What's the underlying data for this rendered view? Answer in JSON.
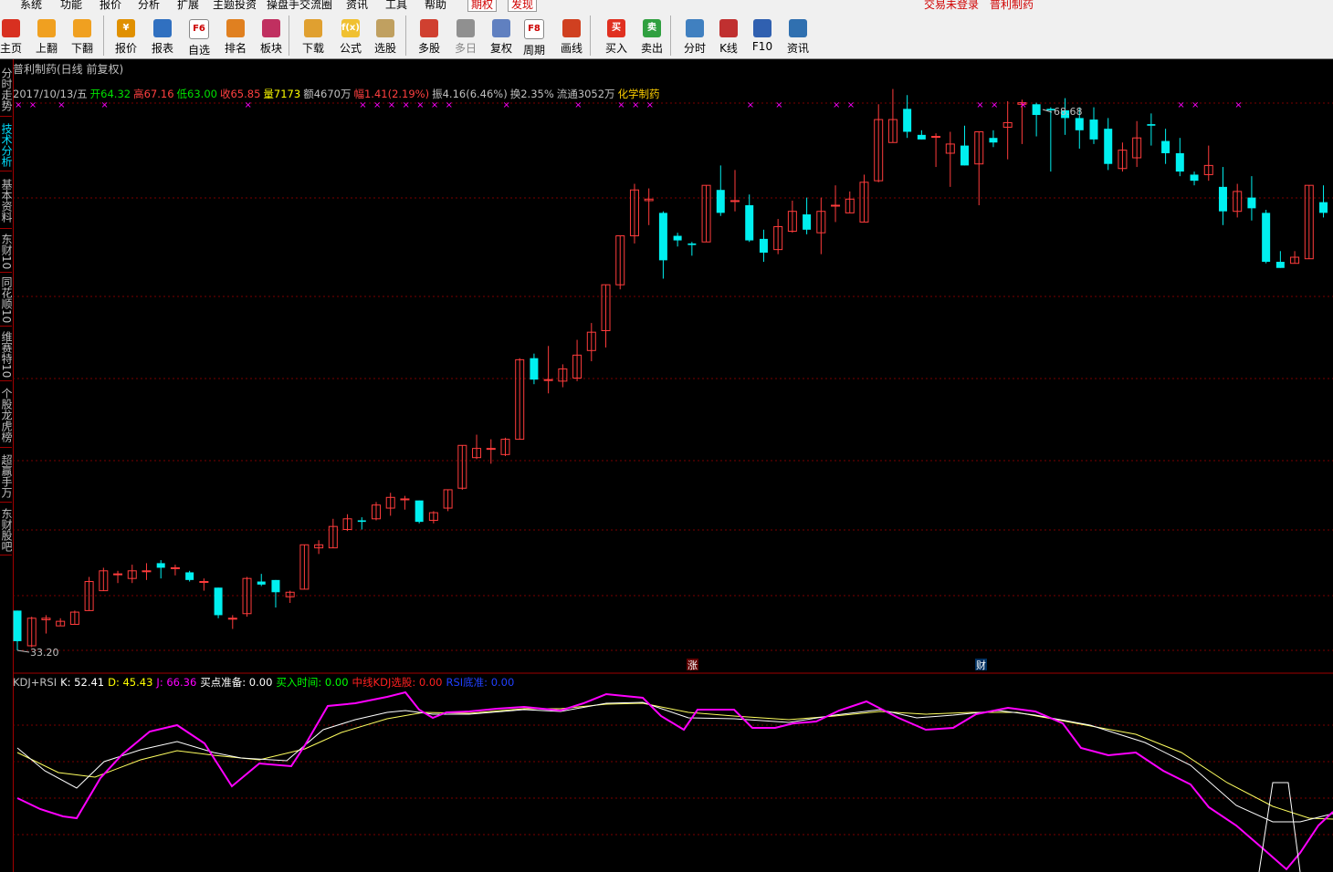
{
  "menu": {
    "items": [
      "系统",
      "功能",
      "报价",
      "分析",
      "扩展",
      "主题投资",
      "操盘手交流圈",
      "资讯",
      "工具",
      "帮助"
    ],
    "highlight_items": [
      "期权",
      "发现"
    ],
    "status_login": "交易未登录",
    "status_stock": "普利制药"
  },
  "toolbar": [
    {
      "label": "主页",
      "icon": "home-icon",
      "color": "#d83020"
    },
    {
      "label": "上翻",
      "icon": "arrow-up-icon",
      "color": "#f0a020"
    },
    {
      "label": "下翻",
      "icon": "arrow-down-icon",
      "color": "#f0a020"
    },
    {
      "label": "报价",
      "icon": "yen-icon",
      "color": "#e09000",
      "text": "¥"
    },
    {
      "label": "报表",
      "icon": "table-icon",
      "color": "#3070c0"
    },
    {
      "label": "自选",
      "icon": "f6-icon",
      "color": "#ffffff",
      "text": "F6"
    },
    {
      "label": "排名",
      "icon": "ranking-icon",
      "color": "#e08020"
    },
    {
      "label": "板块",
      "icon": "blocks-icon",
      "color": "#c03060"
    },
    {
      "label": "下载",
      "icon": "download-icon",
      "color": "#e0a030"
    },
    {
      "label": "公式",
      "icon": "formula-icon",
      "color": "#f0c030",
      "text": "f(x)"
    },
    {
      "label": "选股",
      "icon": "stock-pick-icon",
      "color": "#c0a060"
    },
    {
      "label": "多股",
      "icon": "multi-stock-icon",
      "color": "#d04030"
    },
    {
      "label": "多日",
      "icon": "clock-icon",
      "color": "#909090",
      "disabled": true
    },
    {
      "label": "复权",
      "icon": "restore-rights-icon",
      "color": "#6080c0"
    },
    {
      "label": "周期",
      "icon": "f8-icon",
      "color": "#ffffff",
      "text": "F8"
    },
    {
      "label": "画线",
      "icon": "pen-icon",
      "color": "#d04020"
    },
    {
      "label": "买入",
      "icon": "buy-icon",
      "color": "#e03020",
      "text": "买"
    },
    {
      "label": "卖出",
      "icon": "sell-icon",
      "color": "#30a040",
      "text": "卖"
    },
    {
      "label": "分时",
      "icon": "intraday-icon",
      "color": "#4080c0"
    },
    {
      "label": "K线",
      "icon": "kline-icon",
      "color": "#c03030"
    },
    {
      "label": "F10",
      "icon": "f10-icon",
      "color": "#3060b0"
    },
    {
      "label": "资讯",
      "icon": "news-icon",
      "color": "#3070b0"
    }
  ],
  "left_tabs": [
    {
      "label": "分时走势",
      "active": false
    },
    {
      "label": "技术分析",
      "active": true
    },
    {
      "label": "基本资料",
      "active": false
    },
    {
      "label": "东财10",
      "active": false
    },
    {
      "label": "同花顺10",
      "active": false
    },
    {
      "label": "维赛特10",
      "active": false
    },
    {
      "label": "个股龙虎榜",
      "active": false
    },
    {
      "label": "超赢手万",
      "active": false
    },
    {
      "label": "东财股吧",
      "active": false
    }
  ],
  "chart": {
    "title": "普利制药(日线 前复权)",
    "info": [
      {
        "text": "2017/10/13/五",
        "color": "#c0c0c0"
      },
      {
        "text": "开64.32",
        "color": "#00e000"
      },
      {
        "text": "高67.16",
        "color": "#ff4040"
      },
      {
        "text": "低63.00",
        "color": "#00e000"
      },
      {
        "text": "收65.85",
        "color": "#ff4040"
      },
      {
        "text": "量7173",
        "color": "#ffff00"
      },
      {
        "text": "额4670万",
        "color": "#c0c0c0"
      },
      {
        "text": "幅1.41(2.19%)",
        "color": "#ff4040"
      },
      {
        "text": "振4.16(6.46%)",
        "color": "#c0c0c0"
      },
      {
        "text": "换2.35%",
        "color": "#c0c0c0"
      },
      {
        "text": "流通3052万",
        "color": "#c0c0c0"
      },
      {
        "text": "化学制药",
        "color": "#ffd000"
      }
    ],
    "max_label": "68.68",
    "min_label": "33.20",
    "marker_zhang": "涨",
    "marker_cai": "财",
    "kdj_info": [
      {
        "text": "KDJ+RSI",
        "color": "#c0c0c0"
      },
      {
        "text": "K: 52.41",
        "color": "#ffffff"
      },
      {
        "text": "D: 45.43",
        "color": "#ffff00"
      },
      {
        "text": "J: 66.36",
        "color": "#ff00ff"
      },
      {
        "text": "买点准备: 0.00",
        "color": "#ffffff"
      },
      {
        "text": "买入时间: 0.00",
        "color": "#00ff00"
      },
      {
        "text": "中线KDJ选股: 0.00",
        "color": "#ff2020"
      },
      {
        "text": "RSI底准: 0.00",
        "color": "#2040ff"
      }
    ]
  },
  "chart_data": {
    "type": "candlestick",
    "price_range": [
      33.2,
      68.68
    ],
    "candles": [
      {
        "o": 35.8,
        "h": 35.8,
        "c": 33.8,
        "l": 33.2
      },
      {
        "o": 33.5,
        "h": 35.4,
        "c": 35.3,
        "l": 33.4
      },
      {
        "o": 35.2,
        "h": 35.5,
        "c": 35.3,
        "l": 34.3
      },
      {
        "o": 34.8,
        "h": 35.3,
        "c": 35.1,
        "l": 34.8
      },
      {
        "o": 34.9,
        "h": 35.8,
        "c": 35.7,
        "l": 34.9
      },
      {
        "o": 35.8,
        "h": 38.0,
        "c": 37.7,
        "l": 35.8
      },
      {
        "o": 37.1,
        "h": 38.6,
        "c": 38.4,
        "l": 37.1
      },
      {
        "o": 38.2,
        "h": 38.4,
        "c": 38.2,
        "l": 37.6
      },
      {
        "o": 37.9,
        "h": 38.8,
        "c": 38.4,
        "l": 37.6
      },
      {
        "o": 38.4,
        "h": 38.9,
        "c": 38.4,
        "l": 37.8
      },
      {
        "o": 38.9,
        "h": 39.1,
        "c": 38.6,
        "l": 37.9
      },
      {
        "o": 38.6,
        "h": 38.8,
        "c": 38.6,
        "l": 38.1
      },
      {
        "o": 38.3,
        "h": 38.4,
        "c": 37.8,
        "l": 37.7
      },
      {
        "o": 37.7,
        "h": 37.9,
        "c": 37.7,
        "l": 37.1
      },
      {
        "o": 37.3,
        "h": 37.3,
        "c": 35.5,
        "l": 35.3
      },
      {
        "o": 35.3,
        "h": 35.5,
        "c": 35.3,
        "l": 34.6
      },
      {
        "o": 35.6,
        "h": 38.0,
        "c": 37.9,
        "l": 35.4
      },
      {
        "o": 37.7,
        "h": 38.2,
        "c": 37.5,
        "l": 37.4
      },
      {
        "o": 37.8,
        "h": 37.8,
        "c": 37.0,
        "l": 36.0
      },
      {
        "o": 36.7,
        "h": 37.1,
        "c": 37.0,
        "l": 36.3
      },
      {
        "o": 37.2,
        "h": 40.0,
        "c": 40.1,
        "l": 37.2
      },
      {
        "o": 39.9,
        "h": 40.4,
        "c": 40.1,
        "l": 39.5
      },
      {
        "o": 39.9,
        "h": 41.8,
        "c": 41.3,
        "l": 39.9
      },
      {
        "o": 41.1,
        "h": 42.1,
        "c": 41.8,
        "l": 41.0
      },
      {
        "o": 41.7,
        "h": 41.9,
        "c": 41.6,
        "l": 41.1
      },
      {
        "o": 41.8,
        "h": 42.9,
        "c": 42.7,
        "l": 41.7
      },
      {
        "o": 42.5,
        "h": 43.5,
        "c": 43.2,
        "l": 42.0
      },
      {
        "o": 43.1,
        "h": 43.3,
        "c": 43.1,
        "l": 42.4
      },
      {
        "o": 43.0,
        "h": 43.0,
        "c": 41.6,
        "l": 41.5
      },
      {
        "o": 41.7,
        "h": 42.3,
        "c": 42.2,
        "l": 41.5
      },
      {
        "o": 42.5,
        "h": 43.7,
        "c": 43.7,
        "l": 42.3
      },
      {
        "o": 43.8,
        "h": 46.6,
        "c": 46.6,
        "l": 43.7
      },
      {
        "o": 45.8,
        "h": 47.3,
        "c": 46.4,
        "l": 45.7
      },
      {
        "o": 46.4,
        "h": 47.0,
        "c": 46.4,
        "l": 45.4
      },
      {
        "o": 46.0,
        "h": 47.1,
        "c": 47.0,
        "l": 45.9
      },
      {
        "o": 47.0,
        "h": 52.3,
        "c": 52.2,
        "l": 47.0
      },
      {
        "o": 52.3,
        "h": 52.6,
        "c": 50.9,
        "l": 50.6
      },
      {
        "o": 50.9,
        "h": 53.1,
        "c": 50.9,
        "l": 50.0
      },
      {
        "o": 50.8,
        "h": 51.9,
        "c": 51.6,
        "l": 50.4
      },
      {
        "o": 51.0,
        "h": 53.5,
        "c": 52.5,
        "l": 50.8
      },
      {
        "o": 52.8,
        "h": 54.6,
        "c": 54.0,
        "l": 52.1
      },
      {
        "o": 54.1,
        "h": 57.1,
        "c": 57.1,
        "l": 53.0
      },
      {
        "o": 57.1,
        "h": 60.3,
        "c": 60.3,
        "l": 56.8
      },
      {
        "o": 60.3,
        "h": 63.7,
        "c": 63.3,
        "l": 59.8
      },
      {
        "o": 62.6,
        "h": 63.4,
        "c": 62.7,
        "l": 61.0
      },
      {
        "o": 61.8,
        "h": 61.9,
        "c": 58.7,
        "l": 57.5
      },
      {
        "o": 60.3,
        "h": 60.5,
        "c": 60.0,
        "l": 59.6
      },
      {
        "o": 59.8,
        "h": 59.9,
        "c": 59.7,
        "l": 59.0
      },
      {
        "o": 59.9,
        "h": 63.6,
        "c": 63.6,
        "l": 59.9
      },
      {
        "o": 63.3,
        "h": 64.9,
        "c": 61.8,
        "l": 61.6
      },
      {
        "o": 62.6,
        "h": 64.6,
        "c": 62.6,
        "l": 61.9
      },
      {
        "o": 62.3,
        "h": 63.0,
        "c": 60.0,
        "l": 59.9
      },
      {
        "o": 60.1,
        "h": 60.7,
        "c": 59.2,
        "l": 58.6
      },
      {
        "o": 59.4,
        "h": 61.4,
        "c": 60.9,
        "l": 59.1
      },
      {
        "o": 60.6,
        "h": 62.6,
        "c": 61.9,
        "l": 60.5
      },
      {
        "o": 61.7,
        "h": 62.8,
        "c": 60.7,
        "l": 60.4
      },
      {
        "o": 60.5,
        "h": 62.8,
        "c": 61.9,
        "l": 59.1
      },
      {
        "o": 62.3,
        "h": 63.6,
        "c": 62.3,
        "l": 61.2
      },
      {
        "o": 61.8,
        "h": 63.2,
        "c": 62.7,
        "l": 61.8
      },
      {
        "o": 61.2,
        "h": 64.3,
        "c": 63.8,
        "l": 61.3
      },
      {
        "o": 63.9,
        "h": 68.9,
        "c": 67.9,
        "l": 63.8
      },
      {
        "o": 66.4,
        "h": 69.9,
        "c": 67.9,
        "l": 67.0
      },
      {
        "o": 68.6,
        "h": 69.5,
        "c": 67.1,
        "l": 66.7
      },
      {
        "o": 66.9,
        "h": 67.2,
        "c": 66.6,
        "l": 66.6
      },
      {
        "o": 66.8,
        "h": 67.0,
        "c": 66.8,
        "l": 64.8
      },
      {
        "o": 65.7,
        "h": 67.1,
        "c": 66.3,
        "l": 63.5
      },
      {
        "o": 66.2,
        "h": 67.5,
        "c": 64.9,
        "l": 64.9
      },
      {
        "o": 65.0,
        "h": 66.8,
        "c": 67.1,
        "l": 62.3
      },
      {
        "o": 66.7,
        "h": 67.2,
        "c": 66.4,
        "l": 66.1
      },
      {
        "o": 67.4,
        "h": 69.1,
        "c": 67.7,
        "l": 65.3
      },
      {
        "o": 68.9,
        "h": 69.2,
        "c": 69.0,
        "l": 66.3
      },
      {
        "o": 68.9,
        "h": 69.0,
        "c": 68.2,
        "l": 66.8
      },
      {
        "o": 68.6,
        "h": 68.7,
        "c": 68.5,
        "l": 64.5
      },
      {
        "o": 68.5,
        "h": 69.3,
        "c": 68.0,
        "l": 66.9
      },
      {
        "o": 68.0,
        "h": 68.7,
        "c": 67.2,
        "l": 66.0
      },
      {
        "o": 67.9,
        "h": 68.7,
        "c": 66.6,
        "l": 66.3
      },
      {
        "o": 67.3,
        "h": 68.0,
        "c": 65.0,
        "l": 64.6
      },
      {
        "o": 64.7,
        "h": 66.4,
        "c": 65.9,
        "l": 64.5
      },
      {
        "o": 65.4,
        "h": 67.8,
        "c": 66.7,
        "l": 64.8
      },
      {
        "o": 67.6,
        "h": 68.3,
        "c": 67.5,
        "l": 66.2
      },
      {
        "o": 66.5,
        "h": 67.3,
        "c": 65.7,
        "l": 65.0
      },
      {
        "o": 65.7,
        "h": 66.7,
        "c": 64.5,
        "l": 64.2
      },
      {
        "o": 64.3,
        "h": 64.5,
        "c": 63.9,
        "l": 63.6
      },
      {
        "o": 64.3,
        "h": 66.2,
        "c": 64.9,
        "l": 63.9
      },
      {
        "o": 63.5,
        "h": 64.8,
        "c": 61.9,
        "l": 61.0
      },
      {
        "o": 61.9,
        "h": 63.7,
        "c": 63.2,
        "l": 61.5
      },
      {
        "o": 62.8,
        "h": 64.2,
        "c": 62.1,
        "l": 61.3
      },
      {
        "o": 61.8,
        "h": 62.0,
        "c": 58.6,
        "l": 58.5
      },
      {
        "o": 58.6,
        "h": 59.3,
        "c": 58.2,
        "l": 58.2
      },
      {
        "o": 58.5,
        "h": 59.3,
        "c": 58.9,
        "l": 58.5
      },
      {
        "o": 58.8,
        "h": 63.6,
        "c": 63.6,
        "l": 58.8
      },
      {
        "o": 62.5,
        "h": 63.6,
        "c": 61.8,
        "l": 61.5
      },
      {
        "o": 61.7,
        "h": 62.4,
        "c": 62.0,
        "l": 61.5
      }
    ],
    "kdj": {
      "K": [],
      "D": [],
      "J": []
    }
  }
}
